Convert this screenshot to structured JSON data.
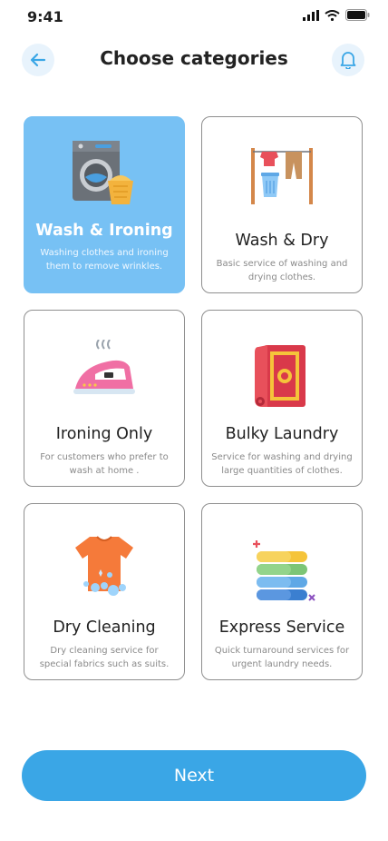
{
  "status": {
    "time": "9:41"
  },
  "header": {
    "title": "Choose categories"
  },
  "categories": [
    {
      "name": "Wash & Ironing",
      "desc": "Washing clothes and ironing them to remove wrinkles.",
      "icon": "washing-machine-icon",
      "selected": true
    },
    {
      "name": "Wash & Dry",
      "desc": "Basic service of washing and drying clothes.",
      "icon": "clothesline-icon",
      "selected": false
    },
    {
      "name": "Ironing Only",
      "desc": "For customers who prefer to wash at home .",
      "icon": "iron-icon",
      "selected": false
    },
    {
      "name": "Bulky Laundry",
      "desc": "Service for washing and drying large quantities of clothes.",
      "icon": "rug-icon",
      "selected": false
    },
    {
      "name": "Dry Cleaning",
      "desc": "Dry cleaning service for special fabrics such as suits.",
      "icon": "tshirt-bubbles-icon",
      "selected": false
    },
    {
      "name": "Express Service",
      "desc": "Quick turnaround services for urgent laundry needs.",
      "icon": "folded-towels-icon",
      "selected": false
    }
  ],
  "actions": {
    "next_label": "Next"
  },
  "colors": {
    "accent": "#3aa6e6",
    "selected_card": "#77c1f4",
    "icon_bg": "#e8f3fc"
  }
}
